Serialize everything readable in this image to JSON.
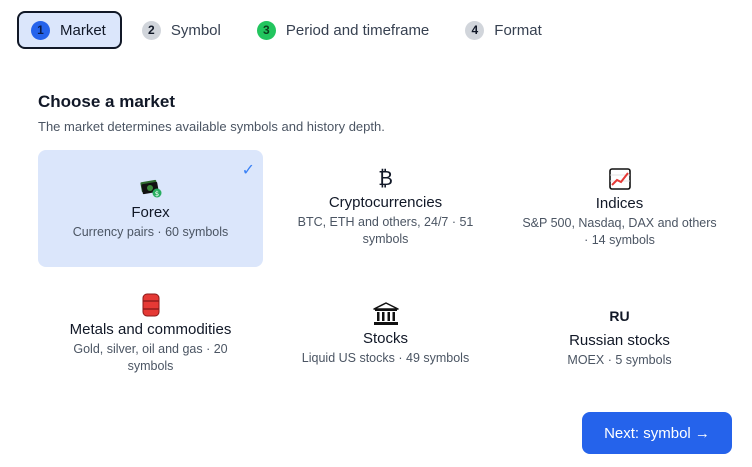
{
  "steps": [
    {
      "num": "1",
      "label": "Market"
    },
    {
      "num": "2",
      "label": "Symbol"
    },
    {
      "num": "3",
      "label": "Period and timeframe"
    },
    {
      "num": "4",
      "label": "Format"
    }
  ],
  "heading": {
    "title": "Choose a market",
    "subtitle": "The market determines available symbols and history depth."
  },
  "markets": [
    {
      "name": "Forex",
      "desc": "Currency pairs · 60 symbols",
      "icon": "money-icon",
      "selected": true,
      "check": "✓"
    },
    {
      "name": "Cryptocurrencies",
      "desc": "BTC, ETH and others, 24/7 · 51 symbols",
      "icon": "bitcoin-icon",
      "glyph": "₿"
    },
    {
      "name": "Indices",
      "desc": "S&P 500, Nasdaq, DAX and others · 14 symbols",
      "icon": "chart-up-icon"
    },
    {
      "name": "Metals and commodities",
      "desc": "Gold, silver, oil and gas · 20 symbols",
      "icon": "oil-barrel-icon"
    },
    {
      "name": "Stocks",
      "desc": "Liquid US stocks · 49 symbols",
      "icon": "bank-icon"
    },
    {
      "name": "Russian stocks",
      "desc": "MOEX · 5 symbols",
      "icon": "ru-badge-icon",
      "glyph": "RU"
    }
  ],
  "next_button": {
    "label": "Next: symbol →"
  },
  "colors": {
    "accent": "#2563eb",
    "selected_bg": "#dbe6fb",
    "step_done": "#22c55e"
  }
}
